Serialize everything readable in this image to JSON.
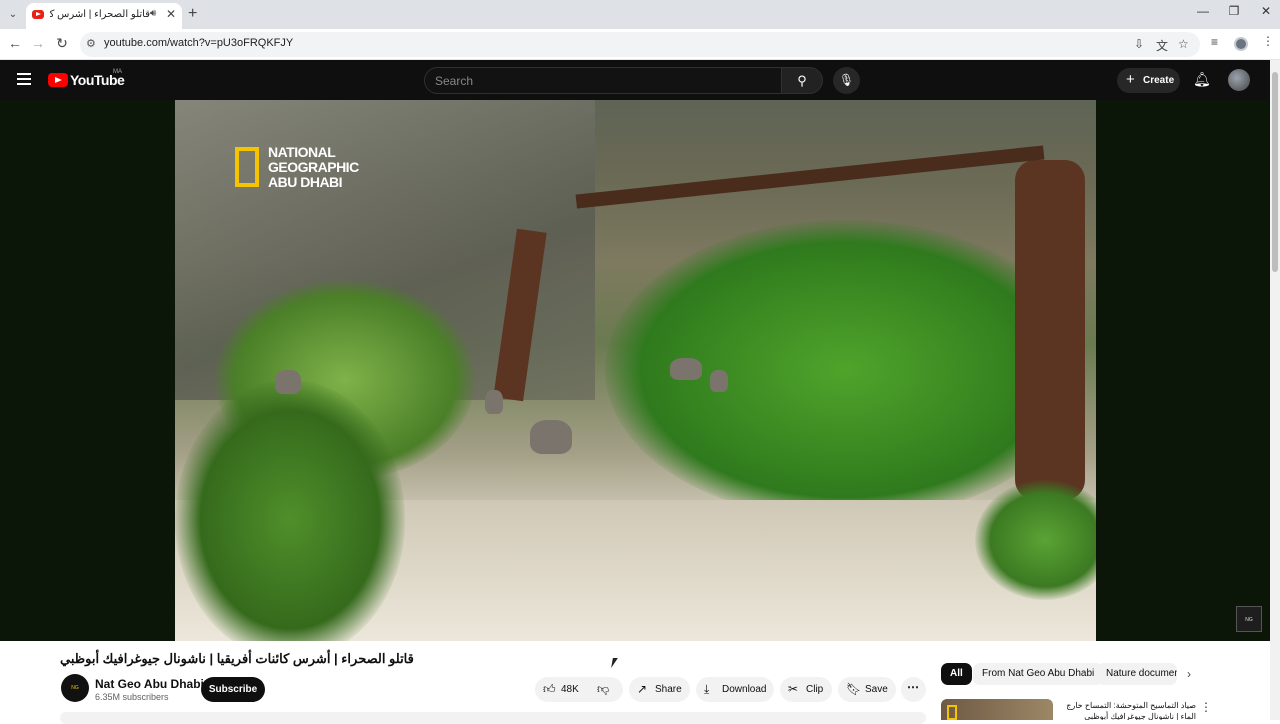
{
  "browser": {
    "tab_title": "قاتلو الصحراء | أشرس كائنات",
    "new_tab_symbol": "+",
    "url": "youtube.com/watch?v=pU3oFRQKFJY"
  },
  "youtube": {
    "logo_text": "YouTube",
    "country_code": "MA",
    "search_placeholder": "Search",
    "create_label": "Create"
  },
  "video": {
    "watermark_lines": "NATIONAL GEOGRAPHIC ABU DHABI",
    "title": "قاتلو الصحراء | أشرس كائنات أفريقيا | ناشونال جيوغرافيك أبوظبي"
  },
  "channel": {
    "name": "Nat Geo Abu Dhabi",
    "subscribers": "6.35M subscribers",
    "subscribe_label": "Subscribe"
  },
  "actions": {
    "likes": "48K",
    "share": "Share",
    "download": "Download",
    "clip": "Clip",
    "save": "Save"
  },
  "chips": [
    "All",
    "From Nat Geo Abu Dhabi",
    "Nature documentaries"
  ],
  "recommended": {
    "title": "صياد التماسيح المتوحشة: التمساح خارج الماء | ناشونال جيوغرافيك أبوظبي"
  },
  "icons": [
    "back-icon",
    "forward-icon",
    "reload-icon",
    "site-info-icon",
    "install-icon",
    "translate-icon",
    "bookmark-star-icon",
    "reading-list-icon",
    "menu-icon",
    "hamburger-icon",
    "search-icon",
    "mic-icon",
    "bell-icon",
    "like-icon",
    "dislike-icon",
    "share-icon",
    "download-icon",
    "clip-icon",
    "save-icon",
    "more-icon",
    "chevron-right-icon"
  ]
}
